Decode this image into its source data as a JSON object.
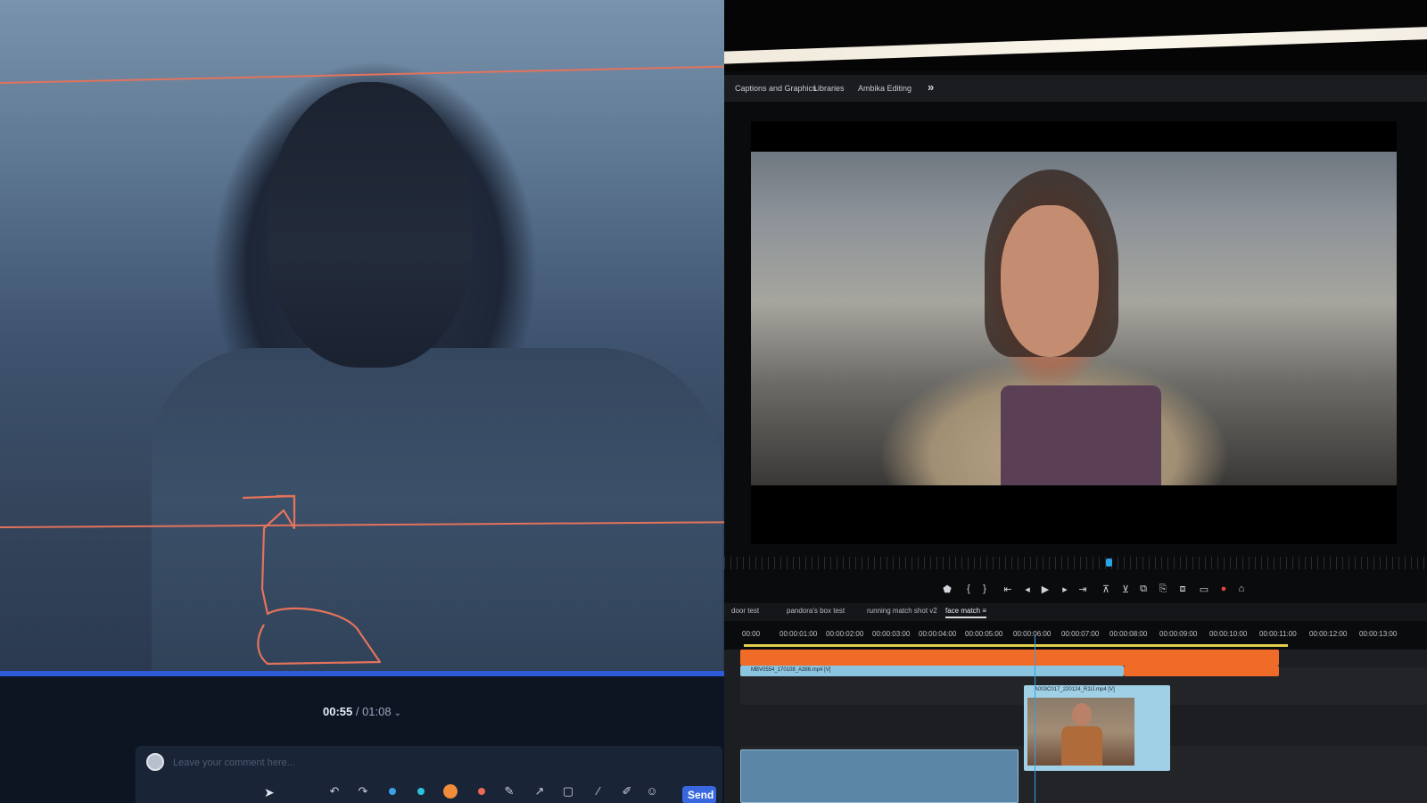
{
  "review_player": {
    "current_time": "00:55",
    "separator": " / ",
    "duration": "01:08",
    "duration_chevron": "⌄",
    "comment_placeholder": "Leave your comment here...",
    "send_label": "Send",
    "annotation_color": "#e3735c",
    "progress_color": "#2f5ad6",
    "tool_icons": [
      "undo-icon",
      "redo-icon",
      "color-dot-blue",
      "color-dot-cyan",
      "color-dot-orange",
      "color-dot-red",
      "pen-icon",
      "arrow-icon",
      "square-icon",
      "line-icon",
      "brush-icon",
      "emoji-icon"
    ]
  },
  "editor": {
    "workspace_tabs": [
      "Captions and Graphics",
      "Libraries",
      "Ambika Editing"
    ],
    "workspace_more": "»",
    "sequence_tabs": [
      {
        "label": "door test"
      },
      {
        "label": "pandora's box test"
      },
      {
        "label": "running match shot v2"
      },
      {
        "label": "face match",
        "menu": "≡",
        "active": true
      }
    ],
    "ruler_timecodes": [
      "00:00",
      "00:00:01:00",
      "00:00:02:00",
      "00:00:03:00",
      "00:00:04:00",
      "00:00:05:00",
      "00:00:06:00",
      "00:00:07:00",
      "00:00:08:00",
      "00:00:09:00",
      "00:00:10:00",
      "00:00:11:00",
      "00:00:12:00",
      "00:00:13:00"
    ],
    "clips": {
      "orange_clip": "",
      "blue_clip": "MBV0554_170108_A386.mp4 [V]",
      "face_clip": "A003C017_220124_R1IJ.mp4 [V]"
    },
    "colors": {
      "playhead": "#2aa4e6",
      "orange_clip": "#f06a28",
      "blue_clip": "#8cc5e0",
      "work_area": "#e2cf4c"
    }
  }
}
